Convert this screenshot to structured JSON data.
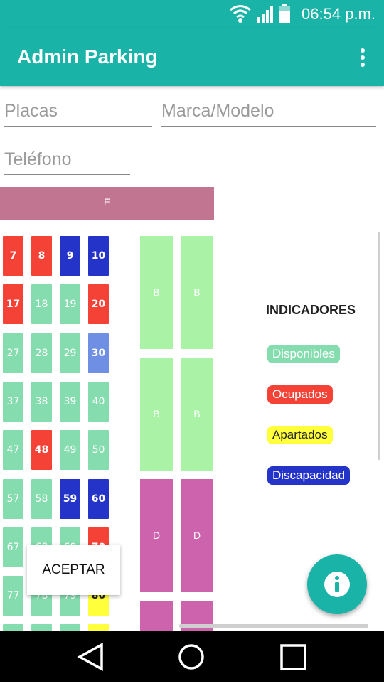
{
  "status_bar": {
    "time": "06:54 p.m."
  },
  "app_bar": {
    "title": "Admin Parking"
  },
  "form": {
    "placas_placeholder": "Placas",
    "marca_placeholder": "Marca/Modelo",
    "telefono_placeholder": "Teléfono"
  },
  "parking": {
    "section_header": "E",
    "spots": [
      {
        "label": "7",
        "status": "ocupado"
      },
      {
        "label": "8",
        "status": "ocupado"
      },
      {
        "label": "9",
        "status": "discapacidad"
      },
      {
        "label": "10",
        "status": "discapacidad"
      },
      {
        "label": "17",
        "status": "ocupado"
      },
      {
        "label": "18",
        "status": "disponible"
      },
      {
        "label": "19",
        "status": "disponible"
      },
      {
        "label": "20",
        "status": "ocupado"
      },
      {
        "label": "27",
        "status": "disponible"
      },
      {
        "label": "28",
        "status": "disponible"
      },
      {
        "label": "29",
        "status": "disponible"
      },
      {
        "label": "30",
        "status": "reservado"
      },
      {
        "label": "37",
        "status": "disponible"
      },
      {
        "label": "38",
        "status": "disponible"
      },
      {
        "label": "39",
        "status": "disponible"
      },
      {
        "label": "40",
        "status": "disponible"
      },
      {
        "label": "47",
        "status": "disponible"
      },
      {
        "label": "48",
        "status": "ocupado"
      },
      {
        "label": "49",
        "status": "disponible"
      },
      {
        "label": "50",
        "status": "disponible"
      },
      {
        "label": "57",
        "status": "disponible"
      },
      {
        "label": "58",
        "status": "disponible"
      },
      {
        "label": "59",
        "status": "discapacidad"
      },
      {
        "label": "60",
        "status": "discapacidad"
      },
      {
        "label": "67",
        "status": "disponible"
      },
      {
        "label": "68",
        "status": "disponible"
      },
      {
        "label": "69",
        "status": "disponible"
      },
      {
        "label": "70",
        "status": "ocupado"
      },
      {
        "label": "77",
        "status": "disponible"
      },
      {
        "label": "78",
        "status": "disponible"
      },
      {
        "label": "79",
        "status": "disponible"
      },
      {
        "label": "80",
        "status": "apartado"
      },
      {
        "label": "",
        "status": "disponible"
      },
      {
        "label": "",
        "status": "disponible"
      },
      {
        "label": "",
        "status": "disponible"
      },
      {
        "label": "",
        "status": "apartado"
      }
    ],
    "blocks": [
      {
        "label": "B",
        "type": "b"
      },
      {
        "label": "B",
        "type": "b"
      },
      {
        "label": "B",
        "type": "b"
      },
      {
        "label": "B",
        "type": "b"
      },
      {
        "label": "D",
        "type": "d"
      },
      {
        "label": "D",
        "type": "d"
      },
      {
        "label": "",
        "type": "d"
      },
      {
        "label": "",
        "type": "d"
      }
    ]
  },
  "indicators": {
    "title": "INDICADORES",
    "items": [
      {
        "label": "Disponibles",
        "bg": "#85ddaf",
        "fg": "#ffffff"
      },
      {
        "label": "Ocupados",
        "bg": "#f44336",
        "fg": "#ffffff"
      },
      {
        "label": "Apartados",
        "bg": "#ffff3b",
        "fg": "#222222"
      },
      {
        "label": "Discapacidad",
        "bg": "#2434c8",
        "fg": "#ffffff"
      }
    ]
  },
  "dialog": {
    "accept_label": "ACEPTAR"
  },
  "colors": {
    "primary": "#1ab3a8",
    "section_header": "#c27590"
  }
}
